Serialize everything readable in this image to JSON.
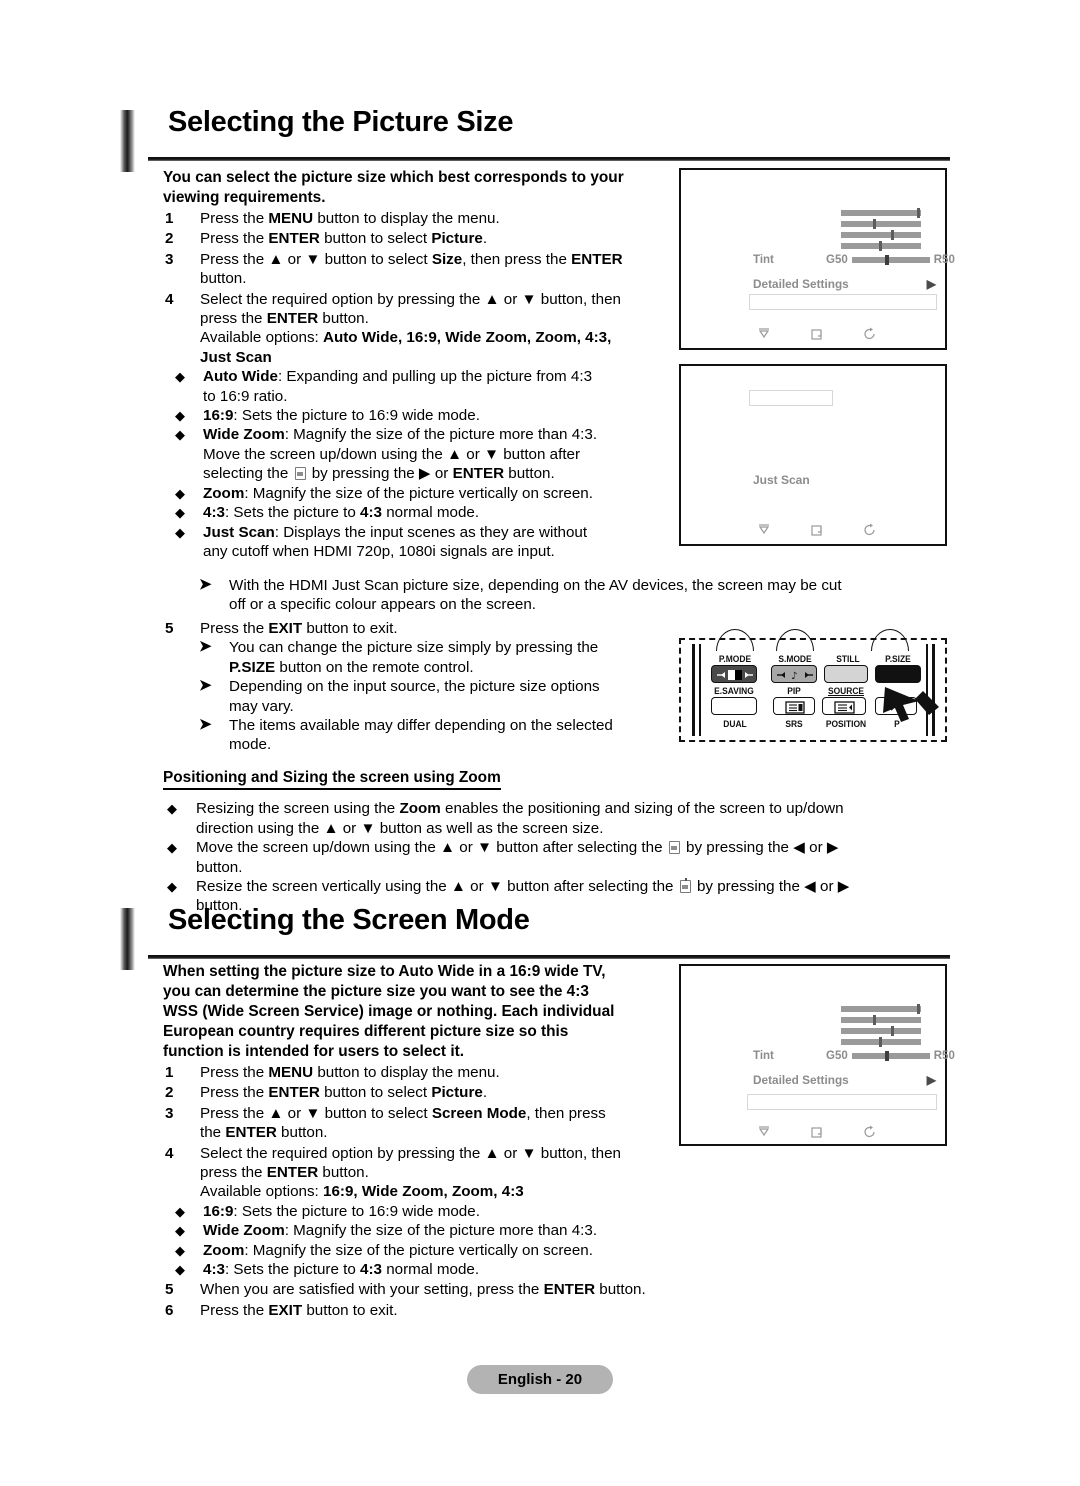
{
  "document": {
    "footer_label": "English - 20"
  },
  "sections": [
    {
      "title": "Selecting the Picture Size",
      "intro_line1": "You can select the picture size which best corresponds to your",
      "intro_line2": "viewing requirements."
    },
    {
      "title": "Selecting the Screen Mode",
      "intro_line1": "When setting the picture size to Auto Wide in a 16:9 wide TV,",
      "intro_line2": "you can determine the picture size you want to see the 4:3",
      "intro_line3": "WSS (Wide Screen Service) image or nothing. Each individual",
      "intro_line4": "European country requires different picture size so this",
      "intro_line5": "function is intended for users to select it."
    }
  ],
  "picture_size": {
    "steps": {
      "s1_num": "1",
      "s1_a": "Press the ",
      "s1_b": "MENU",
      "s1_c": " button to display the menu.",
      "s2_num": "2",
      "s2_a": "Press the ",
      "s2_b": "ENTER",
      "s2_c": " button to select ",
      "s2_d": "Picture",
      "s2_e": ".",
      "s3_num": "3",
      "s3_a": "Press the ▲ or ▼ button to select ",
      "s3_b": "Size",
      "s3_c": ", then press the ",
      "s3_d": "ENTER",
      "s3_e": "button.",
      "s4_num": "4",
      "s4_a": "Select the required option by pressing the ▲ or ▼ button, then",
      "s4_b": "press the ",
      "s4_c": "ENTER",
      "s4_d": " button.",
      "s5_num": "5",
      "s5_a": "Press the ",
      "s5_b": "EXIT",
      "s5_c": " button to exit."
    },
    "available_prefix": "Available options: ",
    "available_options": "Auto Wide, 16:9, Wide Zoom, Zoom, 4:3,",
    "available_options_cont": "Just Scan",
    "options": [
      {
        "name": "Auto Wide",
        "desc_line1": ": Expanding and pulling up the picture from 4:3",
        "desc_line2": "to 16:9 ratio."
      },
      {
        "name": "16:9",
        "desc_line1": ": Sets the picture to 16:9 wide mode."
      },
      {
        "name": "Wide Zoom",
        "desc_line1": ": Magnify the size of the picture more than 4:3.",
        "desc_line2": "Move the screen up/down using the ▲ or ▼ button after",
        "desc_line3a": "selecting the ",
        "desc_line3b": " by pressing the ▶ or ",
        "desc_line3c": "ENTER",
        "desc_line3d": " button."
      },
      {
        "name": "Zoom",
        "desc_line1": ": Magnify the size of the picture vertically on screen."
      },
      {
        "name": "4:3",
        "desc_a": ": Sets the picture to ",
        "desc_b": "4:3",
        "desc_c": " normal mode."
      },
      {
        "name": "Just Scan",
        "desc_line1": ": Displays the input scenes as they are without",
        "desc_line2": "any cutoff when HDMI 720p, 1080i signals are input."
      }
    ],
    "notes": [
      {
        "line1": "With the HDMI Just Scan picture size, depending on the AV devices, the screen may be cut",
        "line2": "off or a specific colour appears on the screen."
      }
    ],
    "exit_notes": [
      {
        "line1": "You can change the picture size simply by pressing the",
        "line2a": "P.SIZE",
        "line2b": " button on the remote control."
      },
      {
        "line1": "Depending on the input source, the picture size options",
        "line2": "may vary."
      },
      {
        "line1": "The items available may differ depending on the selected",
        "line2": "mode."
      }
    ]
  },
  "positioning": {
    "subhead": "Positioning and Sizing the screen using Zoom",
    "bullets": [
      {
        "a": "Resizing the screen using the ",
        "b": "Zoom",
        "c": " enables the positioning and sizing of the screen to up/down",
        "line2": "direction using the ▲ or ▼ button as well as the screen size."
      },
      {
        "a": "Move the screen up/down using the ▲ or ▼ button after selecting the ",
        "c": " by pressing the ◀ or ▶",
        "line2": "button."
      },
      {
        "a": "Resize the screen vertically using the ▲ or ▼ button after selecting the ",
        "c": " by pressing the ◀ or ▶",
        "line2": "button."
      }
    ]
  },
  "screen_mode": {
    "steps": {
      "s1_num": "1",
      "s1_a": "Press the ",
      "s1_b": "MENU",
      "s1_c": " button to display the menu.",
      "s2_num": "2",
      "s2_a": "Press the ",
      "s2_b": "ENTER",
      "s2_c": " button to select ",
      "s2_d": "Picture",
      "s2_e": ".",
      "s3_num": "3",
      "s3_a": "Press the ▲ or ▼ button to select ",
      "s3_b": "Screen Mode",
      "s3_c": ", then press",
      "s3_d": "the ",
      "s3_e": "ENTER",
      "s3_f": " button.",
      "s4_num": "4",
      "s4_a": "Select the required option by pressing the ▲ or ▼ button, then",
      "s4_b": "press the ",
      "s4_c": "ENTER",
      "s4_d": " button.",
      "s5_num": "5",
      "s5_a": "When you are satisfied with your setting, press the ",
      "s5_b": "ENTER",
      "s5_c": " button.",
      "s6_num": "6",
      "s6_a": "Press the ",
      "s6_b": "EXIT",
      "s6_c": " button to exit."
    },
    "available_prefix": "Available options: ",
    "available_options": "16:9, Wide Zoom, Zoom, 4:3",
    "options": [
      {
        "name": "16:9",
        "desc": ": Sets the picture to 16:9 wide mode."
      },
      {
        "name": "Wide Zoom",
        "desc": ": Magnify the size of the picture more than 4:3."
      },
      {
        "name": "Zoom",
        "desc": ": Magnify the size of the picture vertically on screen."
      },
      {
        "name": "4:3",
        "desc_a": ": Sets the picture to ",
        "desc_b": "4:3",
        "desc_c": " normal mode."
      }
    ]
  },
  "tv_menu": {
    "tint_label": "Tint",
    "green_label": "G50",
    "red_label": "R50",
    "detailed_settings_label": "Detailed Settings",
    "just_scan_label": "Just Scan",
    "slider_values": [
      97,
      41,
      63,
      48
    ],
    "tint_value": 48,
    "foot_icons": [
      "move-icon",
      "enter-icon",
      "return-icon"
    ]
  },
  "remote": {
    "top_row_labels": [
      "P.MODE",
      "S.MODE",
      "STILL",
      "P.SIZE"
    ],
    "mid_row_labels": [
      "E.SAVING",
      "PIP",
      "SOURCE"
    ],
    "bottom_row_labels": [
      "DUAL",
      "SRS",
      "POSITION",
      "P"
    ],
    "highlighted_button": "P.SIZE",
    "button_colors": {
      "pmode": "#4a4a4a",
      "smode": "#a8a8a8",
      "still": "#d4d4d4",
      "psize": "#111111"
    }
  },
  "colors": {
    "menu_gray": "#9a9a9a",
    "menu_text": "#8c8c8c",
    "footer_bg": "#b3b3b3",
    "rule": "#111111"
  }
}
